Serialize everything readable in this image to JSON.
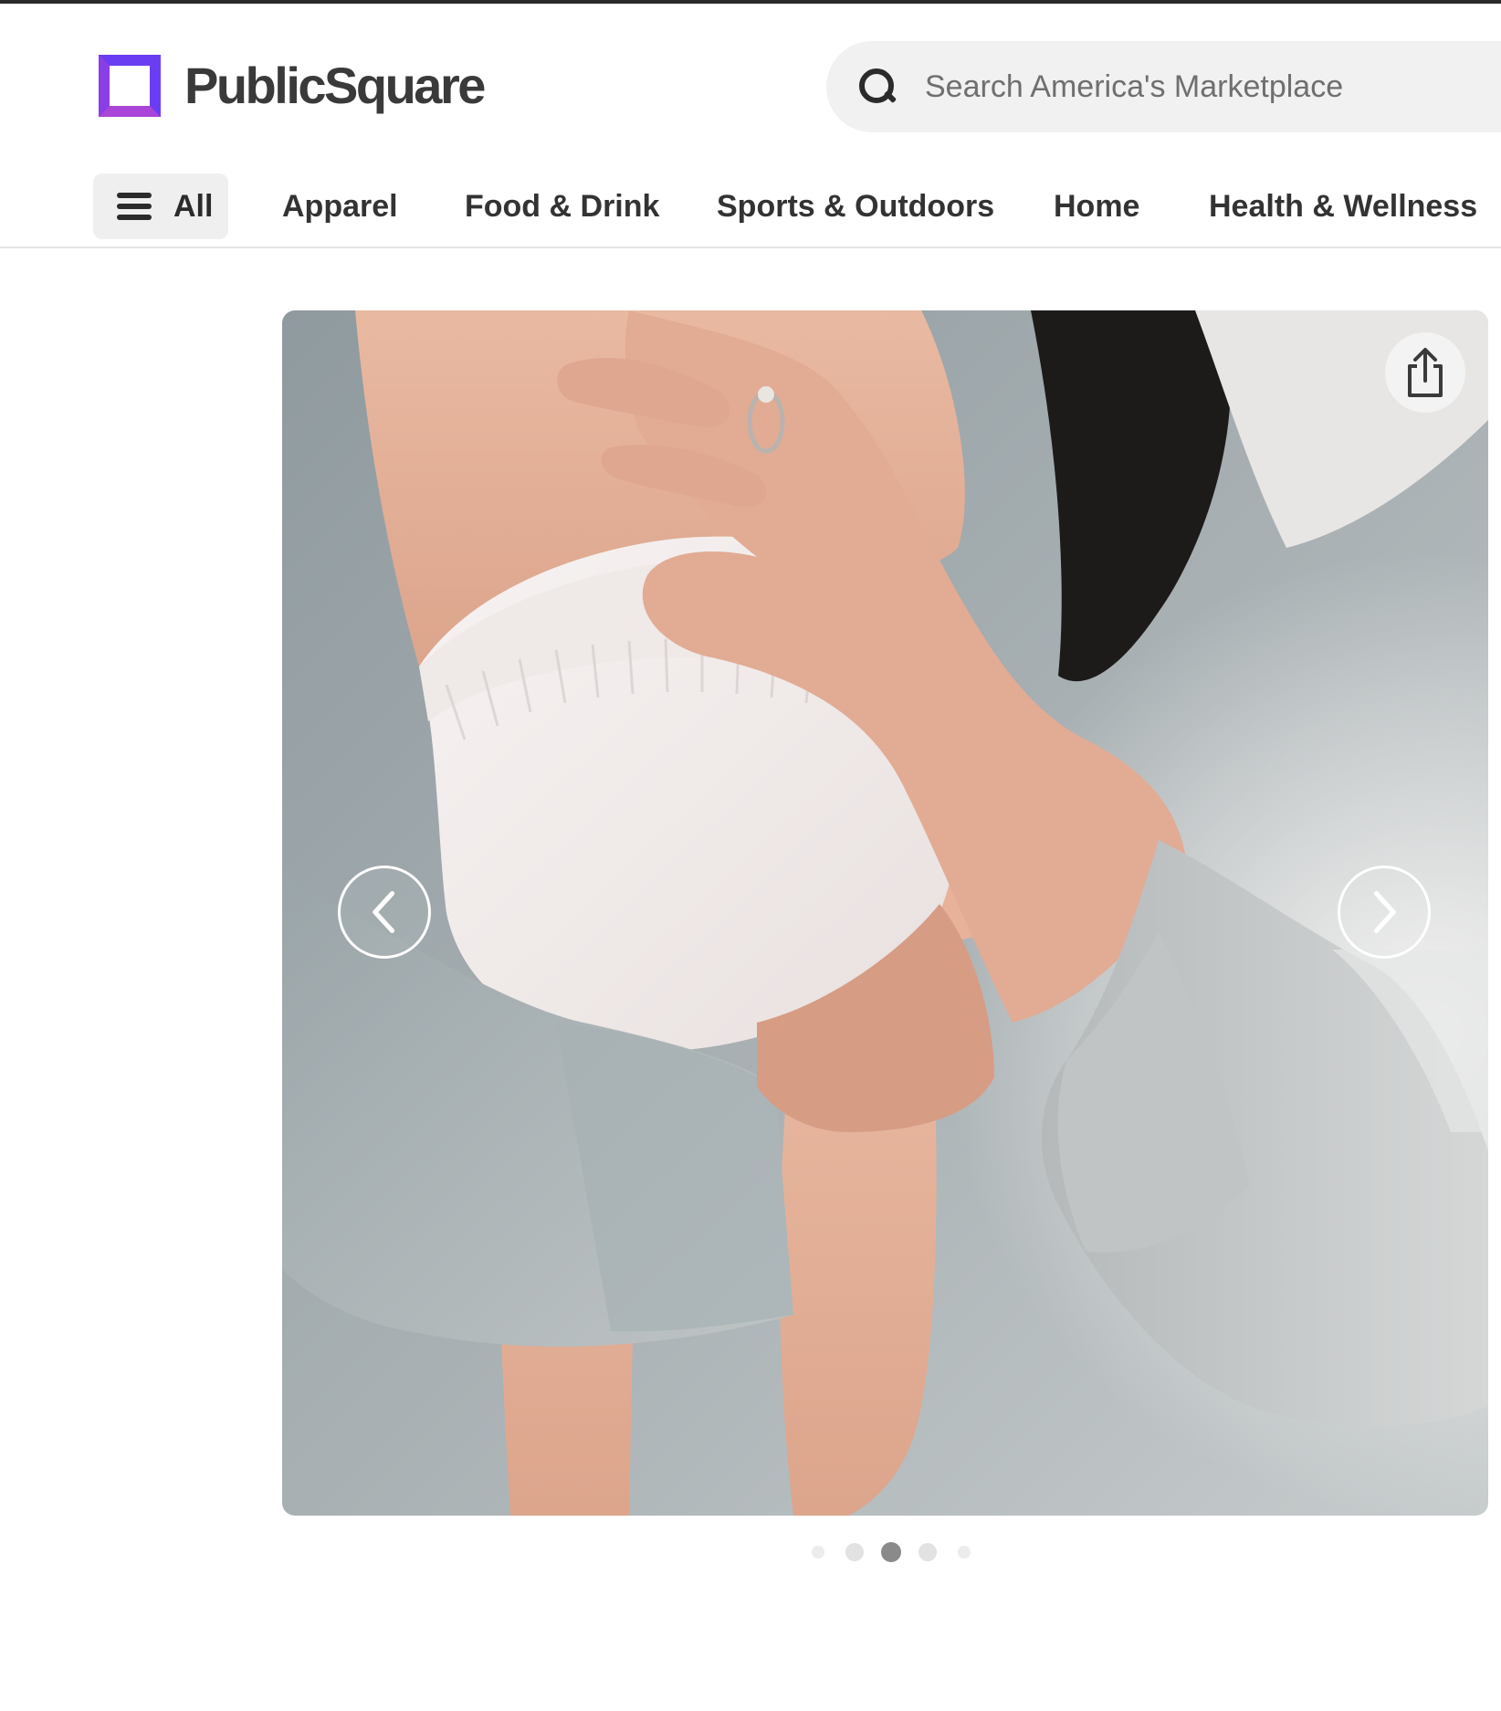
{
  "brand": {
    "name": "PublicSquare",
    "logo_icon": "square-outline-logo-icon",
    "accent_colors": [
      "#6b3df2",
      "#a945d8"
    ]
  },
  "search": {
    "placeholder": "Search America's Marketplace",
    "icon": "search-icon"
  },
  "nav": {
    "all_label": "All",
    "all_icon": "menu-icon",
    "items": [
      {
        "label": "Apparel"
      },
      {
        "label": "Food & Drink"
      },
      {
        "label": "Sports & Outdoors"
      },
      {
        "label": "Home"
      },
      {
        "label": "Health & Wellness"
      }
    ]
  },
  "carousel": {
    "image_alt": "Person in grey sweatshirt holding a baby wearing a white diaper",
    "share_icon": "share-icon",
    "prev_icon": "chevron-left-icon",
    "next_icon": "chevron-right-icon",
    "slide_count": 5,
    "active_index": 2
  }
}
